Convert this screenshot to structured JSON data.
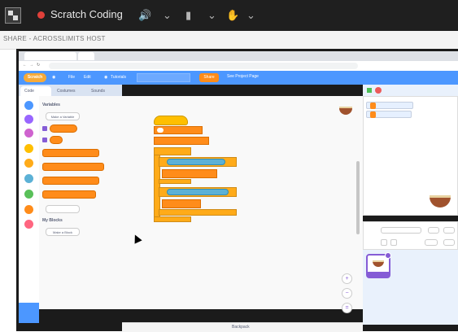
{
  "meeting": {
    "title": "Scratch Coding",
    "share_label": "SHARE - ACROSSLIMITS HOST",
    "controls": [
      "mic-icon",
      "video-icon",
      "raise-hand-icon"
    ]
  },
  "browser": {
    "tab1": "",
    "tab2": "",
    "url": ""
  },
  "scratch": {
    "menu": {
      "logo": "Scratch",
      "file": "File",
      "edit": "Edit",
      "tutorials": "Tutorials",
      "project_title": "",
      "share": "Share",
      "see_project_page": "See Project Page"
    },
    "tabs": {
      "code": "Code",
      "costumes": "Costumes",
      "sounds": "Sounds"
    },
    "palette": {
      "variables_heading": "Variables",
      "make_variable": "Make a Variable",
      "my_blocks_heading": "My Blocks",
      "make_block": "Make a Block"
    },
    "backpack": "Backpack"
  },
  "colors": {
    "scratch_blue": "#4c97ff",
    "variables_orange": "#ff8c1a",
    "events_yellow": "#ffab19",
    "sensing_blue": "#5cb1d6",
    "meeting_bar": "#1f1f1f"
  }
}
